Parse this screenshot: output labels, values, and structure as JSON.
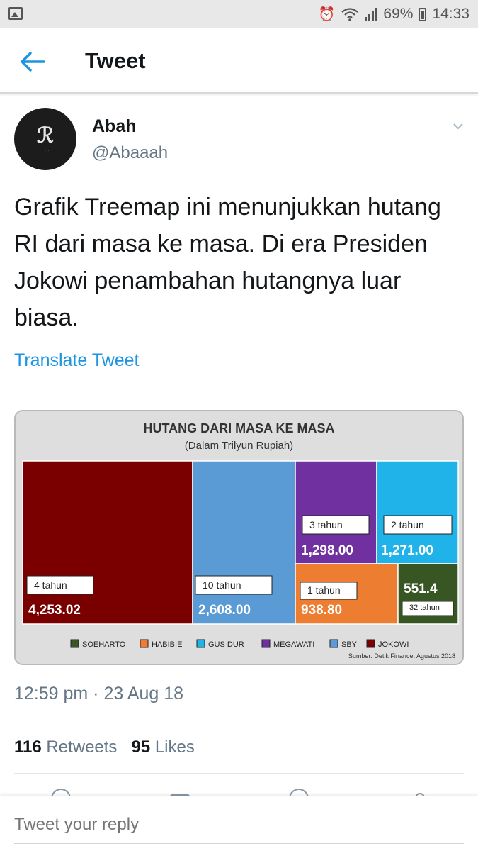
{
  "status_bar": {
    "battery": "69%",
    "time": "14:33",
    "icons": [
      "image-icon",
      "alarm-icon",
      "wifi-icon",
      "signal-icon",
      "battery-icon"
    ]
  },
  "header": {
    "title": "Tweet",
    "back_icon": "arrow-left-icon"
  },
  "tweet": {
    "author_name": "Abah",
    "author_handle": "@Abaaah",
    "text": "Grafik Treemap ini menunjukkan hutang RI dari masa ke masa. Di era Presiden Jokowi penambahan hutangnya luar biasa.",
    "translate_label": "Translate Tweet",
    "timestamp": "12:59 pm · 23 Aug 18",
    "retweets_count": "116",
    "retweets_label": "Retweets",
    "likes_count": "95",
    "likes_label": "Likes"
  },
  "reply": {
    "placeholder": "Tweet your reply"
  },
  "colors": {
    "accent": "#1b95e0",
    "muted": "#657786"
  },
  "chart_data": {
    "type": "treemap",
    "title": "HUTANG DARI MASA KE MASA",
    "subtitle": "(Dalam Trilyun Rupiah)",
    "source": "Sumber: Detik Finance, Agustus 2018",
    "items": [
      {
        "name": "JOKOWI",
        "value": 4253.02,
        "value_label": "4,253.02",
        "period": "4 tahun",
        "color": "#7a0000"
      },
      {
        "name": "SBY",
        "value": 2608.0,
        "value_label": "2,608.00",
        "period": "10 tahun",
        "color": "#5b9bd5"
      },
      {
        "name": "MEGAWATI",
        "value": 1298.0,
        "value_label": "1,298.00",
        "period": "3 tahun",
        "color": "#7030a0"
      },
      {
        "name": "GUS DUR",
        "value": 1271.0,
        "value_label": "1,271.00",
        "period": "2 tahun",
        "color": "#1fb3ea"
      },
      {
        "name": "HABIBIE",
        "value": 938.8,
        "value_label": "938.80",
        "period": "1 tahun",
        "color": "#ed7d31"
      },
      {
        "name": "SOEHARTO",
        "value": 551.4,
        "value_label": "551.4",
        "period": "32 tahun",
        "color": "#375623"
      }
    ],
    "legend": [
      "SOEHARTO",
      "HABIBIE",
      "GUS DUR",
      "MEGAWATI",
      "SBY",
      "JOKOWI"
    ],
    "legend_position": "bottom"
  }
}
